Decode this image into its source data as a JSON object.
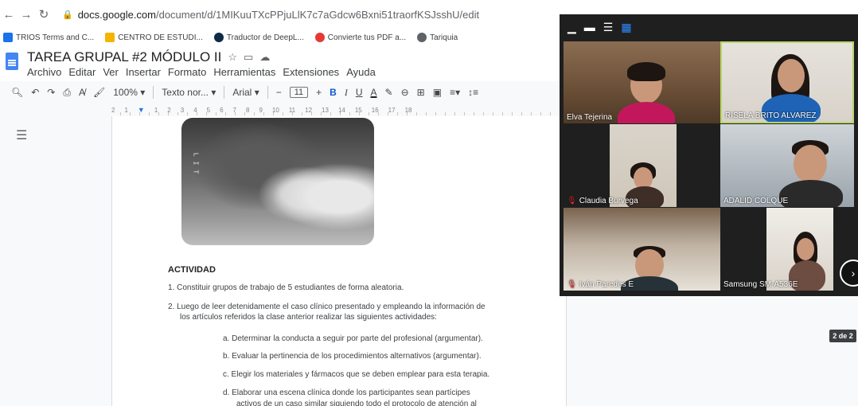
{
  "browser": {
    "url_host": "docs.google.com",
    "url_path": "/document/d/1MIKuuTXcPPjuLlK7c7aGdcw6Bxni51traorfKSJsshU/edit"
  },
  "bookmarks": [
    {
      "label": "TRIOS Terms and C...",
      "color": "#1a73e8"
    },
    {
      "label": "CENTRO DE ESTUDI...",
      "color": "#f4b400"
    },
    {
      "label": "Traductor de DeepL...",
      "color": "#0f2b46"
    },
    {
      "label": "Convierte tus PDF a...",
      "color": "#e53935"
    },
    {
      "label": "Tariquia",
      "color": "#5f6368"
    }
  ],
  "doc": {
    "title": "TAREA GRUPAL #2 MÓDULO II",
    "menu": [
      "Archivo",
      "Editar",
      "Ver",
      "Insertar",
      "Formato",
      "Herramientas",
      "Extensiones",
      "Ayuda"
    ]
  },
  "toolbar": {
    "zoom": "100%",
    "style": "Texto nor...",
    "font": "Arial",
    "size": "11"
  },
  "ruler": [
    "2",
    "1",
    "1",
    "2",
    "3",
    "4",
    "5",
    "6",
    "7",
    "8",
    "9",
    "10",
    "11",
    "12",
    "13",
    "14",
    "15",
    "16",
    "17",
    "18"
  ],
  "content": {
    "xray_label": "L I T",
    "activity_title": "ACTIVIDAD",
    "item1": "1.  Constituir grupos de trabajo de 5 estudiantes de forma aleatoria.",
    "item2": "2.  Luego de leer detenidamente el caso clínico presentado y empleando la información de",
    "item2b": "los artículos referidos la clase anterior realizar las siguientes actividades:",
    "sub_a": "a.   Determinar la conducta a seguir por parte del profesional (argumentar).",
    "sub_b": "b.   Evaluar la pertinencia de los procedimientos alternativos (argumentar).",
    "sub_c": "c.   Elegir los materiales y fármacos que se deben emplear para esta terapia.",
    "sub_d": "d.   Elaborar  una  escena  clínica  donde  los  participantes  sean  partícipes",
    "sub_d2": "activos  de  un  caso  similar  siguiendo  todo  el  protocolo  de  atención  al"
  },
  "page_count": "2 de 2",
  "participants": [
    {
      "name": "Elva Tejerina",
      "muted": false
    },
    {
      "name": "RISELA BRITO ALVAREZ",
      "muted": false
    },
    {
      "name": "Claudia Burvega",
      "muted": true
    },
    {
      "name": "ADALID COLQUE",
      "muted": false
    },
    {
      "name": "Iván Paredes E",
      "muted": true
    },
    {
      "name": "Samsung SM-A536E",
      "muted": false
    }
  ]
}
